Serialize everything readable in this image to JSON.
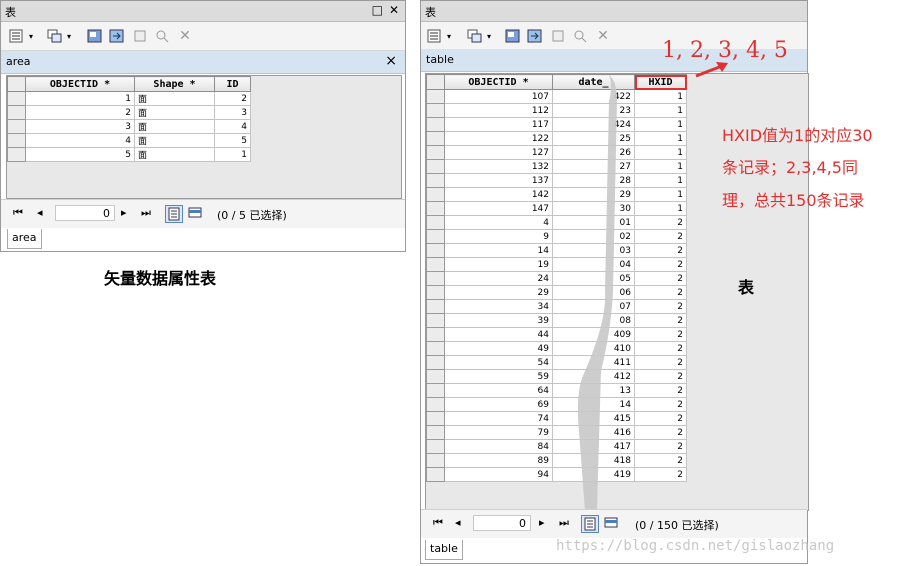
{
  "left_window": {
    "title": "表",
    "tab_title": "area",
    "columns": [
      "OBJECTID *",
      "Shape *",
      "ID"
    ],
    "rows": [
      [
        "1",
        "面",
        "2"
      ],
      [
        "2",
        "面",
        "3"
      ],
      [
        "3",
        "面",
        "4"
      ],
      [
        "4",
        "面",
        "5"
      ],
      [
        "5",
        "面",
        "1"
      ]
    ],
    "record": "0",
    "status": "(0 / 5 已选择)",
    "bottom_tab": "area"
  },
  "right_window": {
    "title": "表",
    "tab_title": "table",
    "columns": [
      "OBJECTID *",
      "date_",
      "HXID"
    ],
    "rows": [
      [
        "107",
        "422",
        "1"
      ],
      [
        "112",
        "23",
        "1"
      ],
      [
        "117",
        "424",
        "1"
      ],
      [
        "122",
        "25",
        "1"
      ],
      [
        "127",
        "26",
        "1"
      ],
      [
        "132",
        "27",
        "1"
      ],
      [
        "137",
        "28",
        "1"
      ],
      [
        "142",
        "29",
        "1"
      ],
      [
        "147",
        "30",
        "1"
      ],
      [
        "4",
        "01",
        "2"
      ],
      [
        "9",
        "02",
        "2"
      ],
      [
        "14",
        "03",
        "2"
      ],
      [
        "19",
        "04",
        "2"
      ],
      [
        "24",
        "05",
        "2"
      ],
      [
        "29",
        "06",
        "2"
      ],
      [
        "34",
        "07",
        "2"
      ],
      [
        "39",
        "08",
        "2"
      ],
      [
        "44",
        "409",
        "2"
      ],
      [
        "49",
        "410",
        "2"
      ],
      [
        "54",
        "411",
        "2"
      ],
      [
        "59",
        "412",
        "2"
      ],
      [
        "64",
        "13",
        "2"
      ],
      [
        "69",
        "14",
        "2"
      ],
      [
        "74",
        "415",
        "2"
      ],
      [
        "79",
        "416",
        "2"
      ],
      [
        "84",
        "417",
        "2"
      ],
      [
        "89",
        "418",
        "2"
      ],
      [
        "94",
        "419",
        "2"
      ]
    ],
    "record": "0",
    "status": "(0 / 150 已选择)",
    "bottom_tab": "table"
  },
  "annotations": {
    "caption_left": "矢量数据属性表",
    "caption_right": "表",
    "sequence": "1, 2, 3, 4, 5",
    "note_line1": "HXID值为1的对应30",
    "note_line2": "条记录；2,3,4,5同",
    "note_line3": "理，总共150条记录",
    "watermark": "https://blog.csdn.net/gislaozhang",
    "accent_color": "#e03030"
  },
  "icons": [
    "table-options-icon",
    "related-tables-icon",
    "select-by-attributes-icon",
    "switch-selection-icon",
    "clear-selection-icon",
    "zoom-to-selected-icon",
    "delete-selected-icon",
    "close-icon",
    "first-record-icon",
    "previous-record-icon",
    "next-record-icon",
    "last-record-icon",
    "show-all-records-icon",
    "show-selected-records-icon"
  ]
}
